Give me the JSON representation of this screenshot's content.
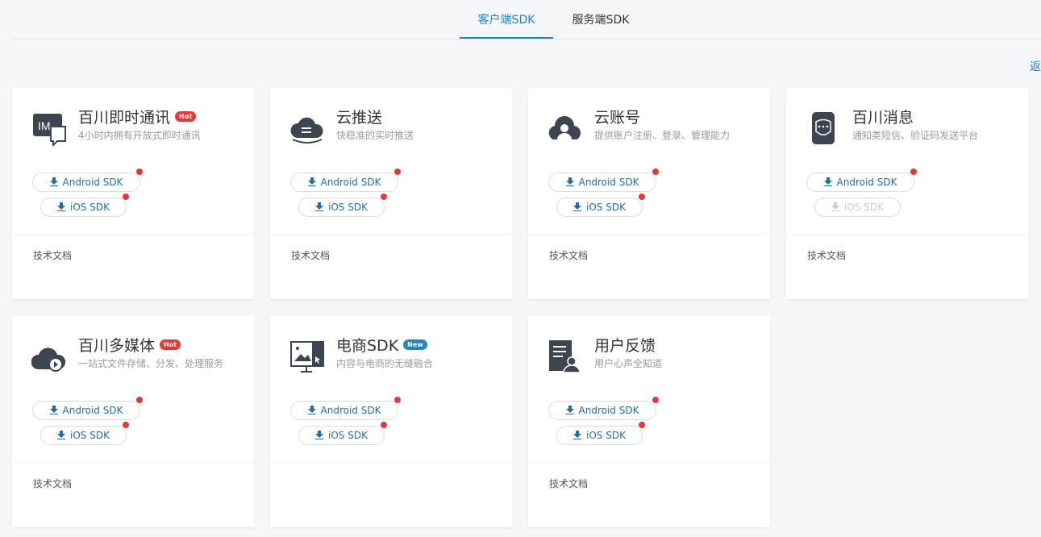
{
  "tabs": [
    {
      "label": "客户端SDK",
      "active": true
    },
    {
      "label": "服务端SDK",
      "active": false
    }
  ],
  "back_link": "返回",
  "accent_color": "#1f85c3",
  "badge_colors": {
    "hot": "#e93737",
    "new": "#1f85c3"
  },
  "cards": [
    {
      "title": "百川即时通讯",
      "badge": "Hot",
      "desc": "4小时内拥有开放式即时通讯",
      "icon": "im-chat-icon",
      "android_label": "Android SDK",
      "ios_label": "iOS SDK",
      "ios_enabled": true,
      "doc_label": "技术文档"
    },
    {
      "title": "云推送",
      "badge": "",
      "desc": "快稳准的实时推送",
      "icon": "cloud-push-icon",
      "android_label": "Android SDK",
      "ios_label": "iOS SDK",
      "ios_enabled": true,
      "doc_label": "技术文档"
    },
    {
      "title": "云账号",
      "badge": "",
      "desc": "提供账户注册、登录、管理能力",
      "icon": "cloud-account-icon",
      "android_label": "Android SDK",
      "ios_label": "iOS SDK",
      "ios_enabled": true,
      "doc_label": "技术文档"
    },
    {
      "title": "百川消息",
      "badge": "",
      "desc": "通知类短信、验证码发送平台",
      "icon": "phone-message-icon",
      "android_label": "Android SDK",
      "ios_label": "iOS SDK",
      "ios_enabled": false,
      "doc_label": "技术文档"
    },
    {
      "title": "百川多媒体",
      "badge": "Hot",
      "desc": "一站式文件存储、分发、处理服务",
      "icon": "cloud-media-icon",
      "android_label": "Android SDK",
      "ios_label": "iOS SDK",
      "ios_enabled": true,
      "doc_label": "技术文档"
    },
    {
      "title": "电商SDK",
      "badge": "New",
      "desc": "内容与电商的无缝融合",
      "icon": "ecommerce-screen-icon",
      "android_label": "Android SDK",
      "ios_label": "iOS SDK",
      "ios_enabled": true,
      "doc_label": ""
    },
    {
      "title": "用户反馈",
      "badge": "",
      "desc": "用户心声全知道",
      "icon": "feedback-user-icon",
      "android_label": "Android SDK",
      "ios_label": "iOS SDK",
      "ios_enabled": true,
      "doc_label": "技术文档"
    }
  ]
}
